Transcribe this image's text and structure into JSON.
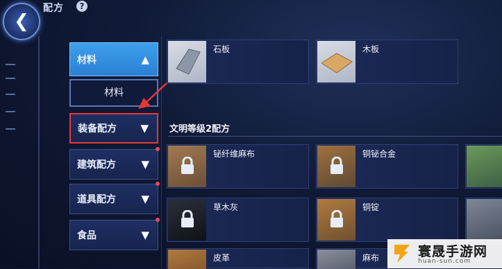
{
  "header": {
    "title": "配方",
    "help": "?",
    "back": "<"
  },
  "sidebar": {
    "materials_label": "材料",
    "materials_sub": "材料",
    "categories": [
      {
        "label": "装备配方",
        "highlighted": true
      },
      {
        "label": "建筑配方",
        "badge": true
      },
      {
        "label": "道具配方",
        "badge": true
      },
      {
        "label": "食品",
        "badge": true
      }
    ]
  },
  "materials": [
    {
      "name": "石板",
      "icon": "stone-slab-icon"
    },
    {
      "name": "木板",
      "icon": "wood-plank-icon"
    }
  ],
  "section": {
    "title": "文明等级2配方",
    "items": [
      {
        "name": "铋纤维麻布",
        "locked": true
      },
      {
        "name": "铜铋合金",
        "locked": true
      },
      {
        "name": "草木灰",
        "locked": true
      },
      {
        "name": "铜锭",
        "locked": true
      },
      {
        "name": "皮革",
        "locked": true
      },
      {
        "name": "麻布",
        "locked": true
      }
    ]
  },
  "colors": {
    "highlight_box": "#e03a3a",
    "selected_tab": "#2b8fe0",
    "background": "#101a36"
  },
  "watermark": {
    "name": "寰晟手游网",
    "url": "huan-sun.com"
  }
}
